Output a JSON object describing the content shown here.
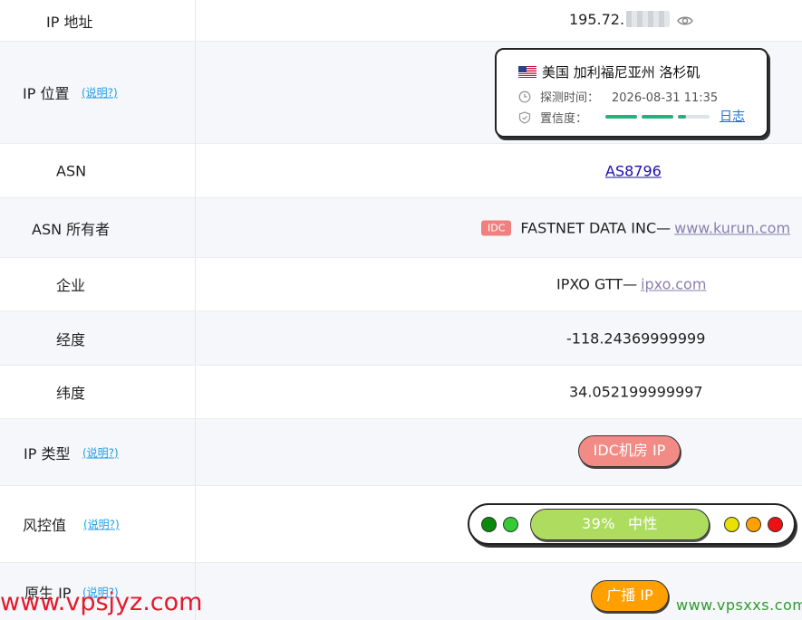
{
  "rows": {
    "ip": {
      "label": "IP 地址",
      "value_prefix": "195.72."
    },
    "location": {
      "label": "IP 位置",
      "help": "(说明?)",
      "place": "美国 加利福尼亚州 洛杉矶",
      "detect_label": "探测时间：",
      "detect_time": "2026-08-31 11:35",
      "confidence_label": "置信度：",
      "confidence_fraction": 0.75,
      "log_link": "日志"
    },
    "asn": {
      "label": "ASN",
      "value": "AS8796"
    },
    "asn_owner": {
      "label": "ASN 所有者",
      "tag": "IDC",
      "name": "FASTNET DATA INC—",
      "domain": "www.kurun.com"
    },
    "enterprise": {
      "label": "企业",
      "name": "IPXO GTT—",
      "domain": "ipxo.com"
    },
    "longitude": {
      "label": "经度",
      "value": "-118.24369999999"
    },
    "latitude": {
      "label": "纬度",
      "value": "34.052199999997"
    },
    "ip_type": {
      "label": "IP 类型",
      "help": "(说明?)",
      "value": "IDC机房 IP"
    },
    "risk": {
      "label": "风控值",
      "help": "(说明?)",
      "score": "39%",
      "level": "中性"
    },
    "native_ip": {
      "label": "原生 IP",
      "help": "(说明?)",
      "value": "广播 IP"
    }
  },
  "colors": {
    "risk_dots_left": [
      "#0a8a0a",
      "#33cc33"
    ],
    "risk_dots_right": [
      "#e8e000",
      "#ffa000",
      "#ee1111"
    ],
    "confidence_on": "#23b27b",
    "confidence_off": "#dde3e8",
    "risk_bar": "#addc5e",
    "ip_type_pill": "#f28b86",
    "broadcast_pill": "#ffa000"
  },
  "watermarks": {
    "left": "www.vpsjyz.com",
    "right": "www.vpsxxs.com"
  }
}
